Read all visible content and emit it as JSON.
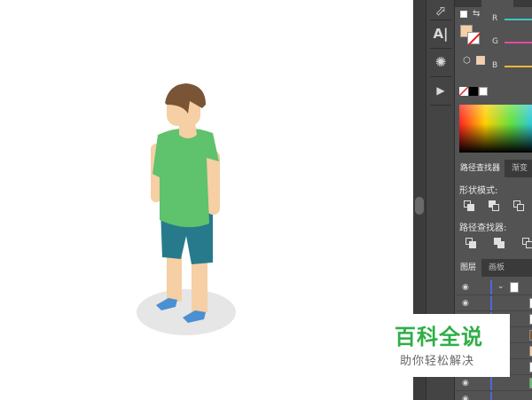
{
  "colors": {
    "canvas_bg": "#ffffff",
    "shadow": "#e6e6e6",
    "hair": "#7a5535",
    "skin": "#f6cfa4",
    "shirt": "#5fc26c",
    "shorts": "#267a8c",
    "shoes": "#4a90d2",
    "panel_bg": "#535353",
    "layer_bar": "#4b6cd8",
    "slider_r": "#3cc6c6",
    "slider_g": "#e04ba4",
    "slider_b": "#e8b83a",
    "watermark_green": "#2fae48"
  },
  "tools": {
    "icons": [
      "artboard-export-icon",
      "type-align-icon",
      "sun-icon",
      "play-icon"
    ]
  },
  "color_panel": {
    "channels": [
      {
        "label": "R"
      },
      {
        "label": "G"
      },
      {
        "label": "B"
      }
    ],
    "fill_color": "#f6cfa4",
    "swatch_color": "#f6cfa4"
  },
  "pathfinder": {
    "tab_active": "路径查找器",
    "tab_inactive": "渐变",
    "shape_modes_label": "形状模式:",
    "pathfinders_label": "路径查找器:"
  },
  "layers": {
    "tab_active": "图层",
    "tab_inactive": "画板",
    "rows": 8
  },
  "watermark": {
    "title": "百科全说",
    "subtitle": "助你轻松解决"
  }
}
